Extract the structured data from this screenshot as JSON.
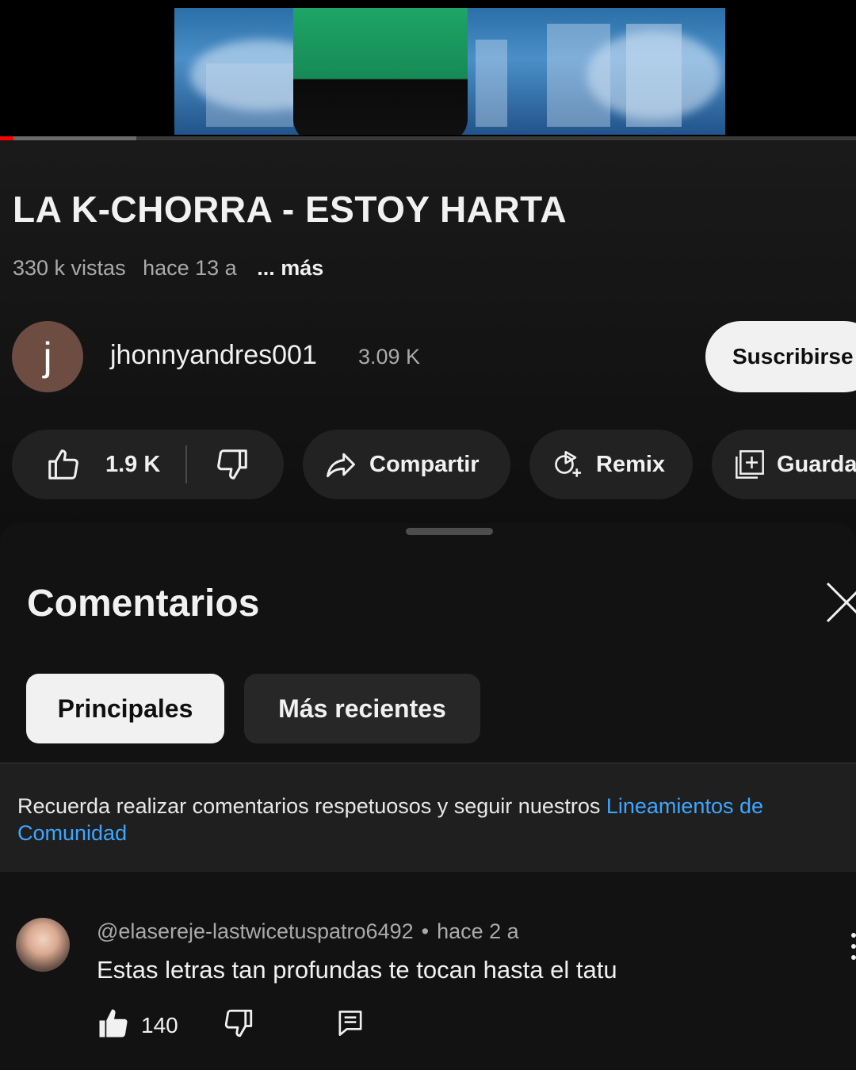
{
  "video": {
    "title": "LA K-CHORRA - ESTOY HARTA",
    "views": "330 k vistas",
    "age": "hace 13 a",
    "more_label": "... más",
    "progress": 0.016
  },
  "channel": {
    "avatar_letter": "j",
    "name": "jhonnyandres001",
    "subscribers": "3.09 K",
    "subscribe_label": "Suscribirse"
  },
  "actions": {
    "like_count": "1.9 K",
    "share_label": "Compartir",
    "remix_label": "Remix",
    "save_label": "Guarda"
  },
  "comments": {
    "title": "Comentarios",
    "tabs": [
      {
        "label": "Principales",
        "active": true
      },
      {
        "label": "Más recientes",
        "active": false
      }
    ],
    "notice_text": "Recuerda realizar comentarios respetuosos y seguir nuestros ",
    "notice_link_1": "Lineamientos de",
    "notice_link_2": "Comunidad",
    "items": [
      {
        "author": "@elasereje-lastwicetuspatro6492",
        "separator": "•",
        "time": "hace 2 a",
        "text": "Estas letras tan profundas te tocan hasta el tatu",
        "likes": "140"
      }
    ]
  },
  "colors": {
    "background": "#0f0f0f",
    "progress": "#ff0000",
    "link": "#3ea6ff",
    "chip_active": "#f1f1f1",
    "pill": "#222222"
  },
  "icons": [
    "like-icon",
    "dislike-icon",
    "share-icon",
    "remix-icon",
    "save-icon",
    "close-icon",
    "more-vert-icon",
    "reply-icon"
  ]
}
